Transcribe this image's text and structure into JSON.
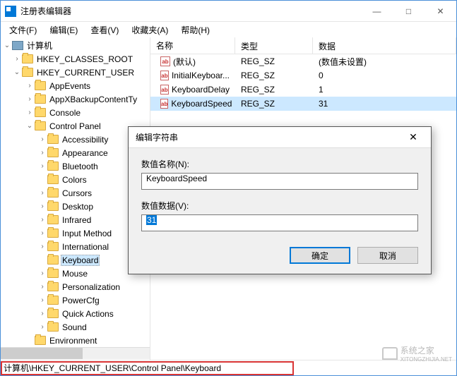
{
  "window": {
    "title": "注册表编辑器",
    "controls": {
      "min": "—",
      "max": "□",
      "close": "✕"
    }
  },
  "menu": {
    "file": "文件(F)",
    "edit": "编辑(E)",
    "view": "查看(V)",
    "favorites": "收藏夹(A)",
    "help": "帮助(H)"
  },
  "tree": {
    "root": "计算机",
    "hkcr": "HKEY_CLASSES_ROOT",
    "hkcu": "HKEY_CURRENT_USER",
    "items": {
      "appevents": "AppEvents",
      "appxbackup": "AppXBackupContentTy",
      "console": "Console",
      "controlpanel": "Control Panel",
      "accessibility": "Accessibility",
      "appearance": "Appearance",
      "bluetooth": "Bluetooth",
      "colors": "Colors",
      "cursors": "Cursors",
      "desktop": "Desktop",
      "infrared": "Infrared",
      "inputmethod": "Input Method",
      "international": "International",
      "keyboard": "Keyboard",
      "mouse": "Mouse",
      "personalization": "Personalization",
      "powercfg": "PowerCfg",
      "quickactions": "Quick Actions",
      "sound": "Sound",
      "environment": "Environment"
    }
  },
  "list": {
    "headers": {
      "name": "名称",
      "type": "类型",
      "data": "数据"
    },
    "rows": [
      {
        "name": "(默认)",
        "type": "REG_SZ",
        "data": "(数值未设置)"
      },
      {
        "name": "InitialKeyboar...",
        "type": "REG_SZ",
        "data": "0"
      },
      {
        "name": "KeyboardDelay",
        "type": "REG_SZ",
        "data": "1"
      },
      {
        "name": "KeyboardSpeed",
        "type": "REG_SZ",
        "data": "31"
      }
    ]
  },
  "dialog": {
    "title": "编辑字符串",
    "name_label": "数值名称(N):",
    "name_value": "KeyboardSpeed",
    "data_label": "数值数据(V):",
    "data_value": "31",
    "ok": "确定",
    "cancel": "取消"
  },
  "statusbar": {
    "path": "计算机\\HKEY_CURRENT_USER\\Control Panel\\Keyboard"
  },
  "watermark": {
    "text": "系统之家",
    "url": "XITONGZHIJIA.NET"
  }
}
